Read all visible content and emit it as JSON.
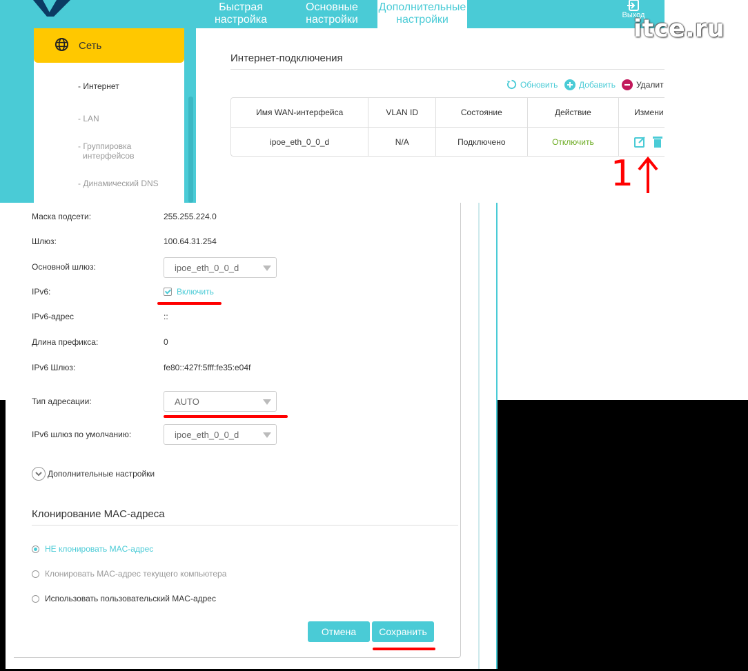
{
  "nav": {
    "tabs": [
      {
        "label_1": "Быстрая",
        "label_2": "настройка"
      },
      {
        "label_1": "Основные",
        "label_2": "настройки"
      },
      {
        "label_1": "Дополнительные",
        "label_2": "настройки"
      }
    ],
    "logout_label": "Выход"
  },
  "watermark": "itce.ru",
  "sidebar": {
    "header": "Сеть",
    "items": [
      {
        "label": "- Интернет"
      },
      {
        "label": "- LAN"
      },
      {
        "label_1": "- Группировка",
        "label_2": "интерфейсов"
      },
      {
        "label": "- Динамический DNS"
      }
    ]
  },
  "internet": {
    "title": "Интернет-подключения",
    "toolbar": {
      "refresh": "Обновить",
      "add": "Добавить",
      "delete": "Удалит"
    },
    "table": {
      "headers": [
        "Имя WAN-интерфейса",
        "VLAN ID",
        "Состояние",
        "Действие",
        "Измени"
      ],
      "row": {
        "name": "ipoe_eth_0_0_d",
        "vlan": "N/A",
        "status": "Подключено",
        "action": "Отключить"
      }
    },
    "annotation": "1"
  },
  "form": {
    "subnet_label": "Маска подсети:",
    "subnet_value": "255.255.224.0",
    "gateway_label": "Шлюз:",
    "gateway_value": "100.64.31.254",
    "main_gateway_label": "Основной шлюз:",
    "main_gateway_value": "ipoe_eth_0_0_d",
    "ipv6_label": "IPv6:",
    "ipv6_enable": "Включить",
    "ipv6_addr_label": "IPv6-адрес",
    "ipv6_addr_value": "::",
    "prefix_label": "Длина префикса:",
    "prefix_value": "0",
    "ipv6_gw_label": "IPv6 Шлюз:",
    "ipv6_gw_value": "fe80::427f:5fff:fe35:e04f",
    "addr_type_label": "Тип адресации:",
    "addr_type_value": "AUTO",
    "ipv6_default_gw_label": "IPv6 шлюз по умолчанию:",
    "ipv6_default_gw_value": "ipoe_eth_0_0_d",
    "advanced": "Дополнительные настройки"
  },
  "mac": {
    "title": "Клонирование MAC-адреса",
    "options": [
      "НЕ клонировать MAC-адрес",
      "Клонировать MAC-адрес текущего компьютера",
      "Использовать пользовательский MAC-адрес"
    ]
  },
  "buttons": {
    "cancel": "Отмена",
    "save": "Сохранить"
  },
  "colors": {
    "accent": "#4acbd6",
    "sidebar_header": "#ffc800",
    "annotation": "#ff0000",
    "action_green": "#6aaa1f"
  }
}
